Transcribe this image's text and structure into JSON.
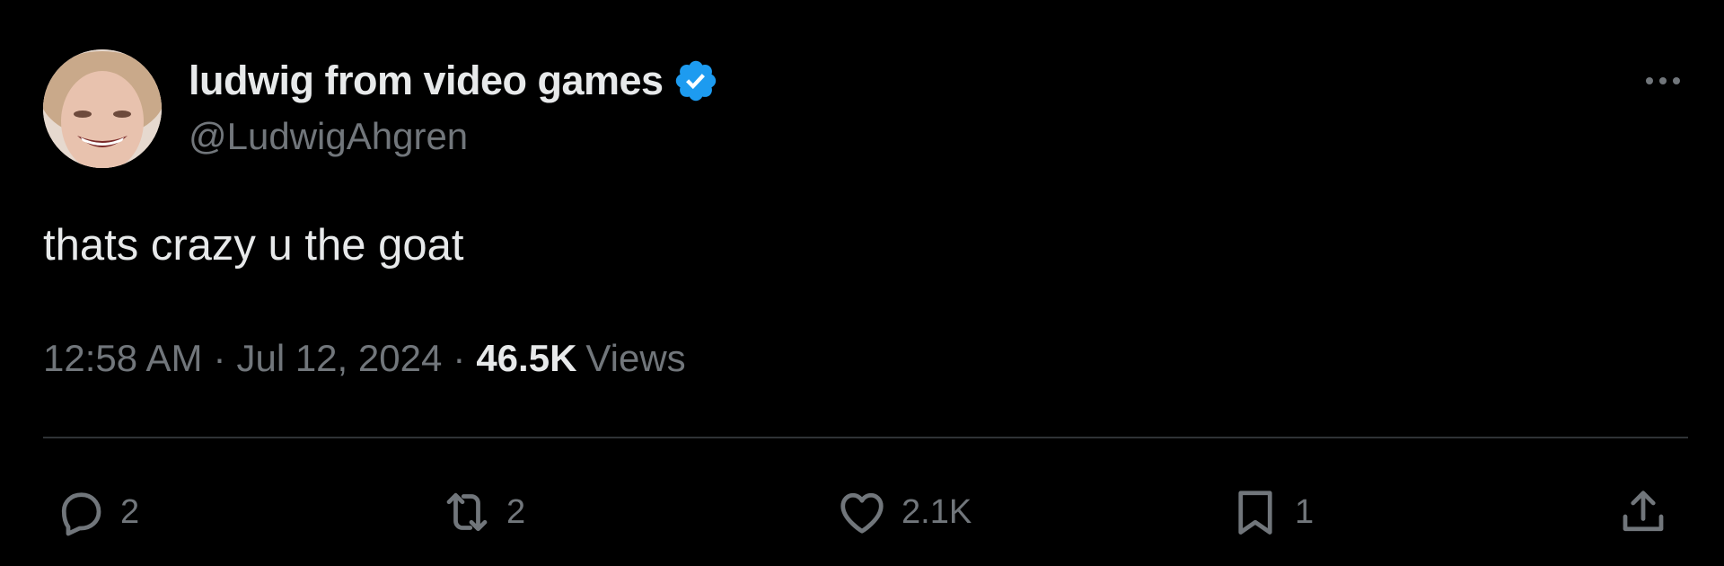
{
  "user": {
    "display_name": "ludwig from video games",
    "handle": "@LudwigAhgren",
    "verified_color": "#1d9bf0"
  },
  "tweet": {
    "text": "thats crazy u the goat",
    "time": "12:58 AM",
    "separator": "·",
    "date": "Jul 12, 2024",
    "views_count": "46.5K",
    "views_label": "Views"
  },
  "actions": {
    "reply_count": "2",
    "retweet_count": "2",
    "like_count": "2.1K",
    "bookmark_count": "1"
  },
  "icons": {
    "more": "more-horizontal-icon",
    "reply": "reply-icon",
    "retweet": "retweet-icon",
    "like": "heart-icon",
    "bookmark": "bookmark-icon",
    "share": "share-icon"
  },
  "colors": {
    "background": "#000000",
    "primary_text": "#e7e9ea",
    "secondary_text": "#71767b",
    "divider": "#2f3336"
  }
}
